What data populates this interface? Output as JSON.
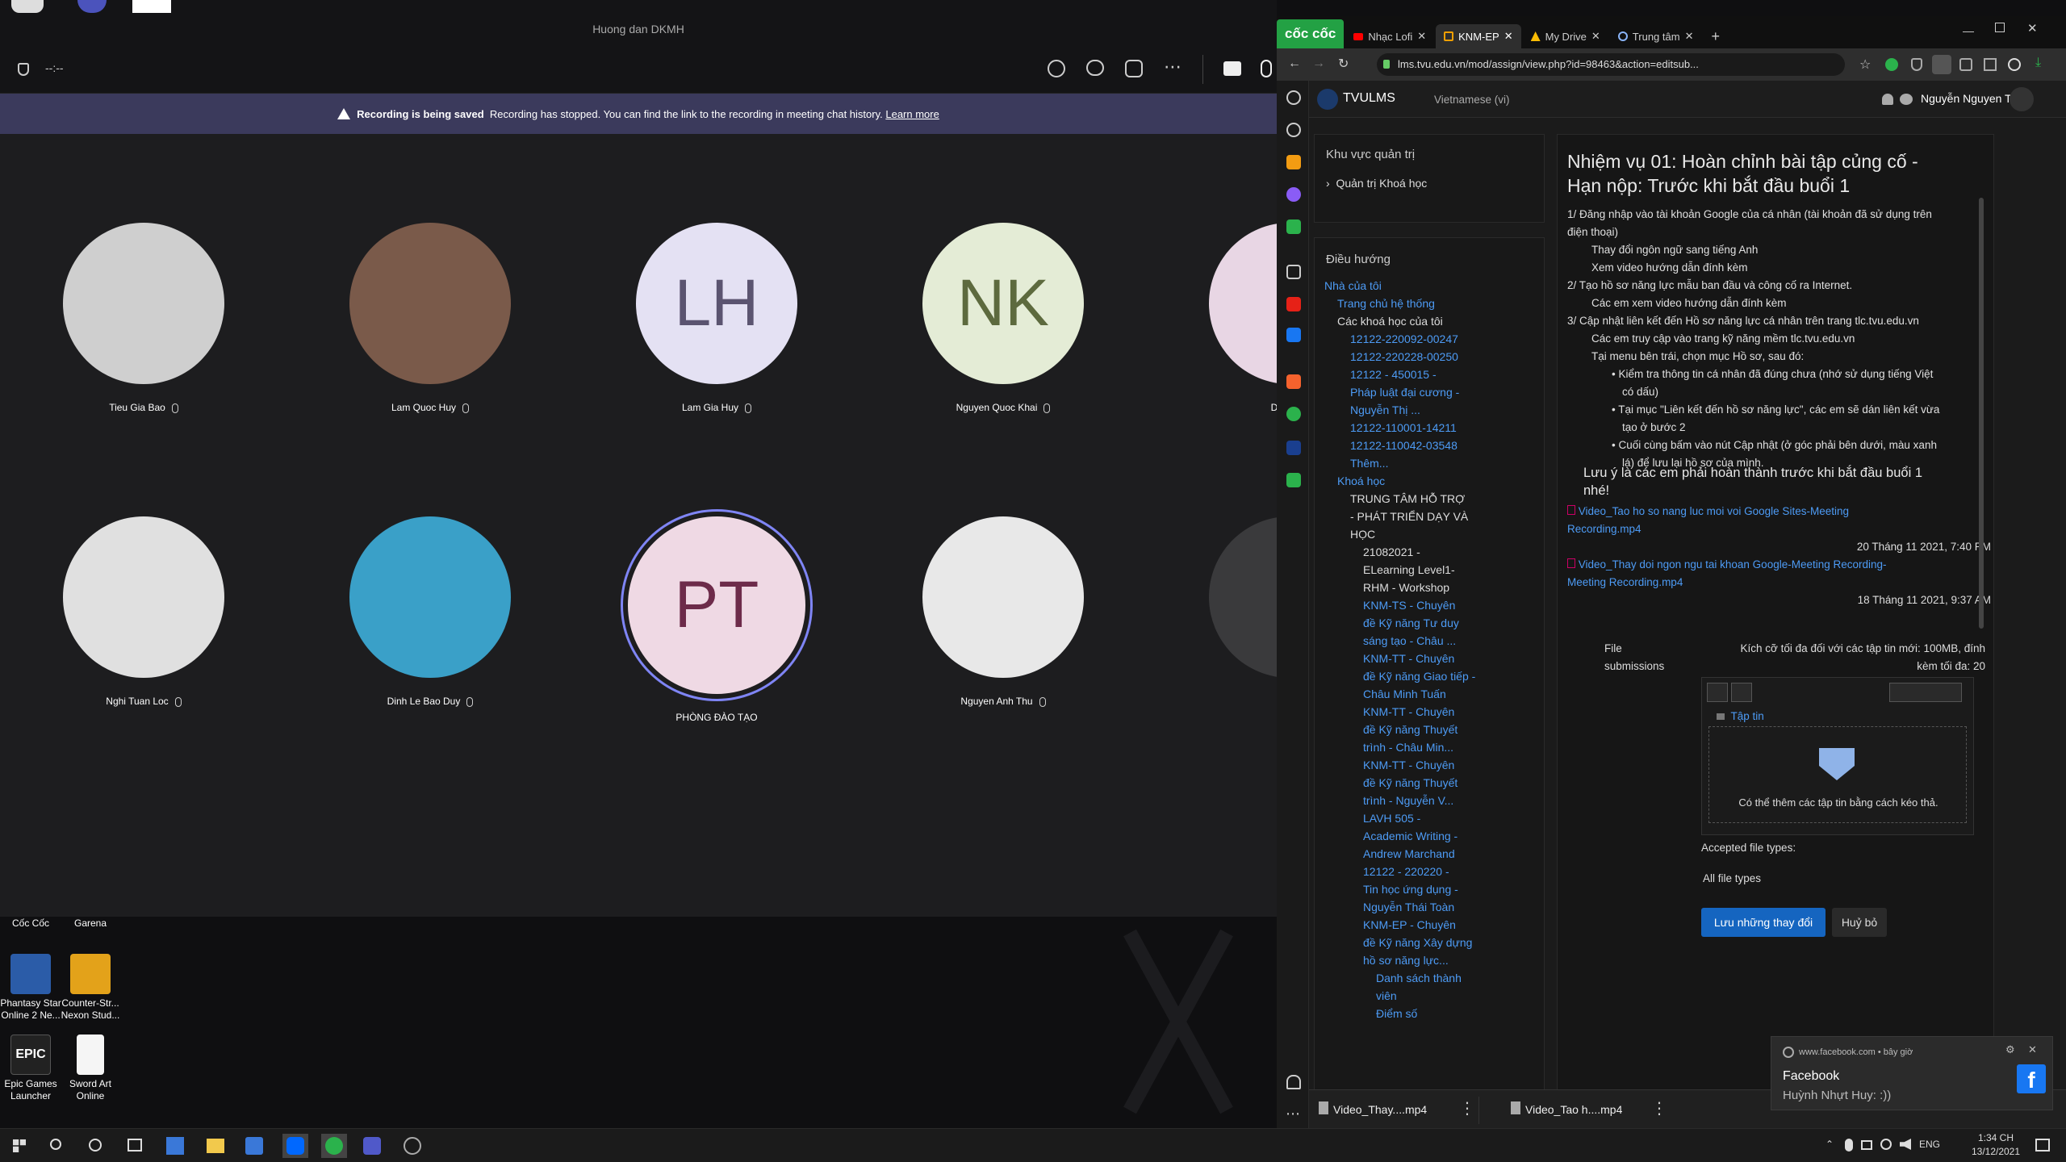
{
  "teams": {
    "window_title": "Huong dan DKMH",
    "timer": "--:--",
    "banner": {
      "bold": "Recording is being saved",
      "text": "Recording has stopped. You can find the link to the recording in meeting chat history.",
      "link": "Learn more"
    },
    "participants": [
      {
        "name": "Tieu Gia Bao",
        "initials": "",
        "color": "#cfcfcf"
      },
      {
        "name": "Lam Quoc Huy",
        "initials": "",
        "color": "#7a5a4a"
      },
      {
        "name": "Lam Gia Huy",
        "initials": "LH",
        "color": "#e4e1f3",
        "fg": "#5b5470"
      },
      {
        "name": "Nguyen Quoc Khai",
        "initials": "NK",
        "color": "#e4ecd6",
        "fg": "#5d6a3e"
      },
      {
        "name": "Diep l",
        "initials": "",
        "color": "#e8d6e4"
      },
      {
        "name": "Nghi Tuan Loc",
        "initials": "",
        "color": "#e0e0e0"
      },
      {
        "name": "Dinh Le Bao Duy",
        "initials": "",
        "color": "#3aa0c8"
      },
      {
        "name": "PHÒNG ĐÀO TẠO",
        "initials": "PT",
        "color": "#efd9e4",
        "fg": "#6d2b4a"
      },
      {
        "name": "Nguyen Anh Thu",
        "initials": "",
        "color": "#e8e8e8"
      },
      {
        "name": "",
        "initials": "",
        "color": "#3a3a3c"
      }
    ]
  },
  "desktop": {
    "top_labels": [
      "Cốc Cốc",
      "Garena"
    ],
    "icons": [
      {
        "label": "Phantasy Star Online 2 Ne...",
        "color": "#2b5ca8"
      },
      {
        "label": "Counter-Str... Nexon Stud...",
        "color": "#e3a21a"
      },
      {
        "label": "Epic Games Launcher",
        "color": "#222"
      },
      {
        "label": "Sword Art Online",
        "color": "#f5f5f5"
      }
    ]
  },
  "browser": {
    "brand": "cốc cốc",
    "tabs": [
      "Nhạc Lofi",
      "KNM-EP",
      "My Drive",
      "Trung tâm"
    ],
    "url": "lms.tvu.edu.vn/mod/assign/view.php?id=98463&action=editsub...",
    "site": "TVULMS",
    "language": "Vietnamese (vi)",
    "user": "Nguyễn Nguyen Tin",
    "admin_title": "Khu vực quản trị",
    "admin_item": "Quản trị Khoá học",
    "nav_title": "Điều hướng",
    "nav": [
      {
        "t": "Nhà của tôi",
        "lvl": 0,
        "w": false
      },
      {
        "t": "Trang chủ hệ thống",
        "lvl": 1,
        "w": false
      },
      {
        "t": "Các khoá học của tôi",
        "lvl": 1,
        "w": true
      },
      {
        "t": "12122-220092-00247",
        "lvl": 2,
        "w": false
      },
      {
        "t": "12122-220228-00250",
        "lvl": 2,
        "w": false
      },
      {
        "t": "12122 - 450015 -",
        "lvl": 2,
        "w": false
      },
      {
        "t": "Pháp luật đại cương -",
        "lvl": 2,
        "w": false
      },
      {
        "t": "Nguyễn Thị ...",
        "lvl": 2,
        "w": false
      },
      {
        "t": "12122-110001-14211",
        "lvl": 2,
        "w": false
      },
      {
        "t": "12122-110042-03548",
        "lvl": 2,
        "w": false
      },
      {
        "t": "Thêm...",
        "lvl": 2,
        "w": false
      },
      {
        "t": "Khoá học",
        "lvl": 1,
        "w": false
      },
      {
        "t": "TRUNG TÂM HỖ TRỢ",
        "lvl": 2,
        "w": true
      },
      {
        "t": "- PHÁT TRIỂN DẠY VÀ",
        "lvl": 2,
        "w": true
      },
      {
        "t": "HỌC",
        "lvl": 2,
        "w": true
      },
      {
        "t": "21082021 -",
        "lvl": 3,
        "w": true
      },
      {
        "t": "ELearning Level1-",
        "lvl": 3,
        "w": true
      },
      {
        "t": "RHM - Workshop",
        "lvl": 3,
        "w": true
      },
      {
        "t": "KNM-TS - Chuyên",
        "lvl": 3,
        "w": false
      },
      {
        "t": "đề Kỹ năng Tư duy",
        "lvl": 3,
        "w": false
      },
      {
        "t": "sáng tạo - Châu ...",
        "lvl": 3,
        "w": false
      },
      {
        "t": "KNM-TT - Chuyên",
        "lvl": 3,
        "w": false
      },
      {
        "t": "đề Kỹ năng Giao tiếp -",
        "lvl": 3,
        "w": false
      },
      {
        "t": "Châu Minh Tuấn",
        "lvl": 3,
        "w": false
      },
      {
        "t": "KNM-TT - Chuyên",
        "lvl": 3,
        "w": false
      },
      {
        "t": "đề Kỹ năng Thuyết",
        "lvl": 3,
        "w": false
      },
      {
        "t": "trình - Châu Min...",
        "lvl": 3,
        "w": false
      },
      {
        "t": "KNM-TT - Chuyên",
        "lvl": 3,
        "w": false
      },
      {
        "t": "đề Kỹ năng Thuyết",
        "lvl": 3,
        "w": false
      },
      {
        "t": "trình - Nguyễn V...",
        "lvl": 3,
        "w": false
      },
      {
        "t": "LAVH 505 -",
        "lvl": 3,
        "w": false
      },
      {
        "t": "Academic Writing -",
        "lvl": 3,
        "w": false
      },
      {
        "t": "Andrew Marchand",
        "lvl": 3,
        "w": false
      },
      {
        "t": "12122 - 220220 -",
        "lvl": 3,
        "w": false
      },
      {
        "t": "Tin học ứng dụng -",
        "lvl": 3,
        "w": false
      },
      {
        "t": "Nguyễn Thái Toàn",
        "lvl": 3,
        "w": false
      },
      {
        "t": "KNM-EP - Chuyên",
        "lvl": 3,
        "w": false
      },
      {
        "t": "đề Kỹ năng Xây dựng",
        "lvl": 3,
        "w": false
      },
      {
        "t": "hồ sơ năng lực...",
        "lvl": 3,
        "w": false
      },
      {
        "t": "Danh sách thành",
        "lvl": 4,
        "w": false
      },
      {
        "t": "viên",
        "lvl": 4,
        "w": false
      },
      {
        "t": "Điểm số",
        "lvl": 4,
        "w": false
      }
    ],
    "task_title_1": "Nhiệm vụ 01: Hoàn chỉnh bài tập củng cố -",
    "task_title_2": "Hạn nộp: Trước khi bắt đầu buổi 1",
    "lines": [
      {
        "t": "1/ Đăng nhập vào tài khoản Google của cá nhân (tài khoản đã sử dụng trên",
        "x": 0
      },
      {
        "t": "điện thoại)",
        "x": 0
      },
      {
        "t": "Thay đổi ngôn ngữ sang tiếng Anh",
        "x": 30
      },
      {
        "t": "Xem video hướng dẫn đính kèm",
        "x": 30
      },
      {
        "t": "2/ Tạo hồ sơ năng lực mẫu ban đầu và công cố ra Internet.",
        "x": 0
      },
      {
        "t": "Các em xem video hướng dẫn đính kèm",
        "x": 30
      },
      {
        "t": "3/ Cập nhật liên kết đến Hồ sơ năng lực cá nhân trên trang tlc.tvu.edu.vn",
        "x": 0
      },
      {
        "t": "Các em truy cập vào trang kỹ năng mềm tlc.tvu.edu.vn",
        "x": 30
      },
      {
        "t": "Tại menu bên trái, chọn mục Hồ sơ, sau đó:",
        "x": 30
      },
      {
        "t": "• Kiểm tra thông tin cá nhân đã đúng chưa (nhớ sử dụng tiếng Việt",
        "x": 55
      },
      {
        "t": "có dấu)",
        "x": 68
      },
      {
        "t": "• Tại mục \"Liên kết đến hồ sơ năng lực\", các em sẽ dán liên kết vừa",
        "x": 55
      },
      {
        "t": "tạo ở bước 2",
        "x": 68
      },
      {
        "t": "• Cuối cùng bấm vào nút Cập nhật (ở góc phải bên dưới, màu xanh",
        "x": 55
      },
      {
        "t": "lá) để lưu lại hồ sơ của mình.",
        "x": 68
      }
    ],
    "note_1": "Lưu ý là các em phải hoàn thành trước khi bắt đầu buổi 1",
    "note_2": "nhé!",
    "files": [
      {
        "name1": "Video_Tao ho so nang luc moi voi Google Sites-Meeting",
        "name2": "Recording.mp4",
        "date": "20 Tháng 11 2021, 7:40 PM"
      },
      {
        "name1": "Video_Thay doi ngon ngu tai khoan Google-Meeting Recording-",
        "name2": "Meeting Recording.mp4",
        "date": "18 Tháng 11 2021, 9:37 AM"
      }
    ],
    "file_submissions": "File submissions",
    "max_size_1": "Kích cỡ tối đa đối với các tập tin mới: 100MB, đính",
    "max_size_2": "kèm tối đa: 20",
    "folder": "Tập tin",
    "drop_text": "Có thể thêm các tập tin bằng cách kéo thả.",
    "accepted_label": "Accepted file types:",
    "accepted_value": "All file types",
    "save_btn": "Lưu những thay đổi",
    "cancel_btn": "Huỷ bỏ",
    "downloads": [
      "Video_Thay....mp4",
      "Video_Tao h....mp4"
    ]
  },
  "toast": {
    "source": "www.facebook.com",
    "time": "bây giờ",
    "title": "Facebook",
    "message": "Huỳnh Nhựt Huy: :))"
  },
  "taskbar": {
    "time": "1:34 CH",
    "date": "13/12/2021",
    "lang": "ENG"
  }
}
